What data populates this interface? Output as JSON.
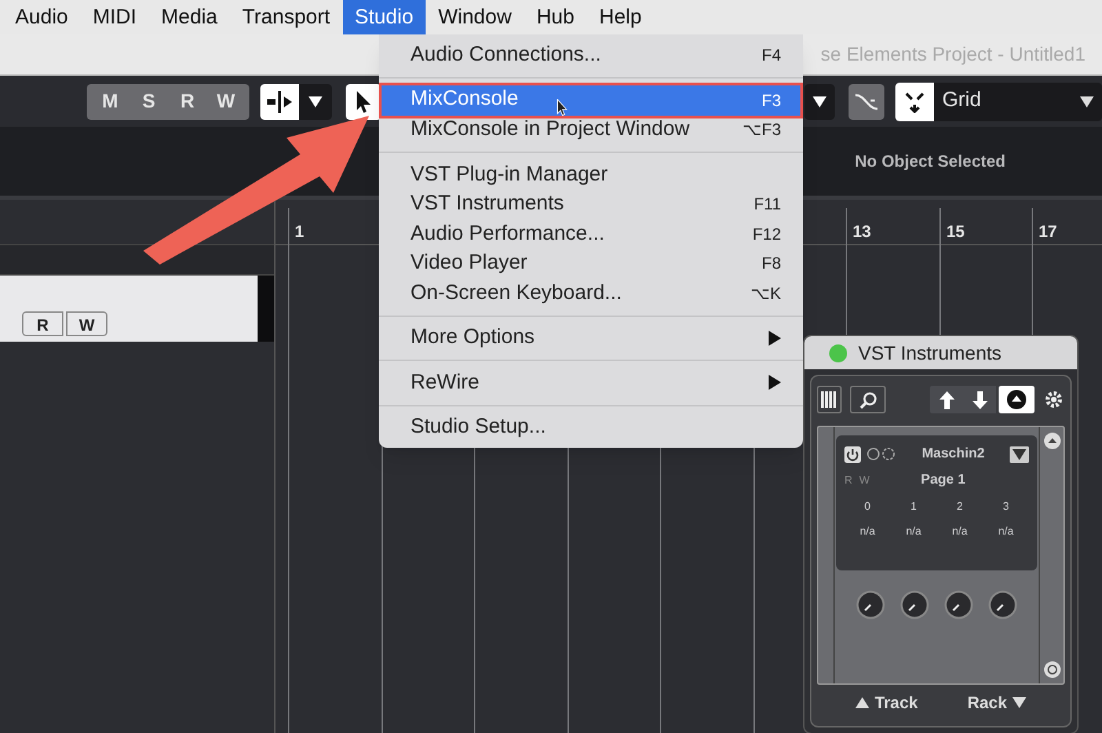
{
  "menubar": [
    {
      "label": "Audio",
      "selected": false
    },
    {
      "label": "MIDI",
      "selected": false
    },
    {
      "label": "Media",
      "selected": false
    },
    {
      "label": "Transport",
      "selected": false
    },
    {
      "label": "Studio",
      "selected": true
    },
    {
      "label": "Window",
      "selected": false
    },
    {
      "label": "Hub",
      "selected": false
    },
    {
      "label": "Help",
      "selected": false
    }
  ],
  "window_title": "se Elements Project - Untitled1",
  "toolbar": {
    "buttons": [
      "M",
      "S",
      "R",
      "W"
    ],
    "snap_mode": "Grid"
  },
  "info_line": "No Object Selected",
  "ruler": [
    "1",
    "13",
    "15",
    "17"
  ],
  "track": {
    "buttons": [
      "R",
      "W"
    ]
  },
  "menu": [
    {
      "kind": "item",
      "label": "Audio Connections...",
      "shortcut": "F4",
      "selected": false
    },
    {
      "kind": "separator"
    },
    {
      "kind": "item",
      "label": "MixConsole",
      "shortcut": "F3",
      "selected": true
    },
    {
      "kind": "item",
      "label": "MixConsole in Project Window",
      "shortcut": "⌥F3",
      "selected": false
    },
    {
      "kind": "separator"
    },
    {
      "kind": "item",
      "label": "VST Plug-in Manager",
      "selected": false
    },
    {
      "kind": "item",
      "label": "VST Instruments",
      "shortcut": "F11",
      "selected": false
    },
    {
      "kind": "item",
      "label": "Audio Performance...",
      "shortcut": "F12",
      "selected": false
    },
    {
      "kind": "item",
      "label": "Video Player",
      "shortcut": "F8",
      "selected": false
    },
    {
      "kind": "item",
      "label": "On-Screen Keyboard...",
      "shortcut": "⌥K",
      "selected": false
    },
    {
      "kind": "separator"
    },
    {
      "kind": "submenu",
      "label": "More Options",
      "selected": false
    },
    {
      "kind": "separator"
    },
    {
      "kind": "submenu",
      "label": "ReWire",
      "selected": false
    },
    {
      "kind": "separator"
    },
    {
      "kind": "item",
      "label": "Studio Setup...",
      "selected": false
    }
  ],
  "vst_window": {
    "title": "VST Instruments",
    "instrument": "Maschin2",
    "page": "Page 1",
    "rw": [
      "R",
      "W"
    ],
    "slots": [
      {
        "number": "0",
        "value": "n/a"
      },
      {
        "number": "1",
        "value": "n/a"
      },
      {
        "number": "2",
        "value": "n/a"
      },
      {
        "number": "3",
        "value": "n/a"
      }
    ],
    "footer": [
      "Track",
      "Rack"
    ]
  }
}
